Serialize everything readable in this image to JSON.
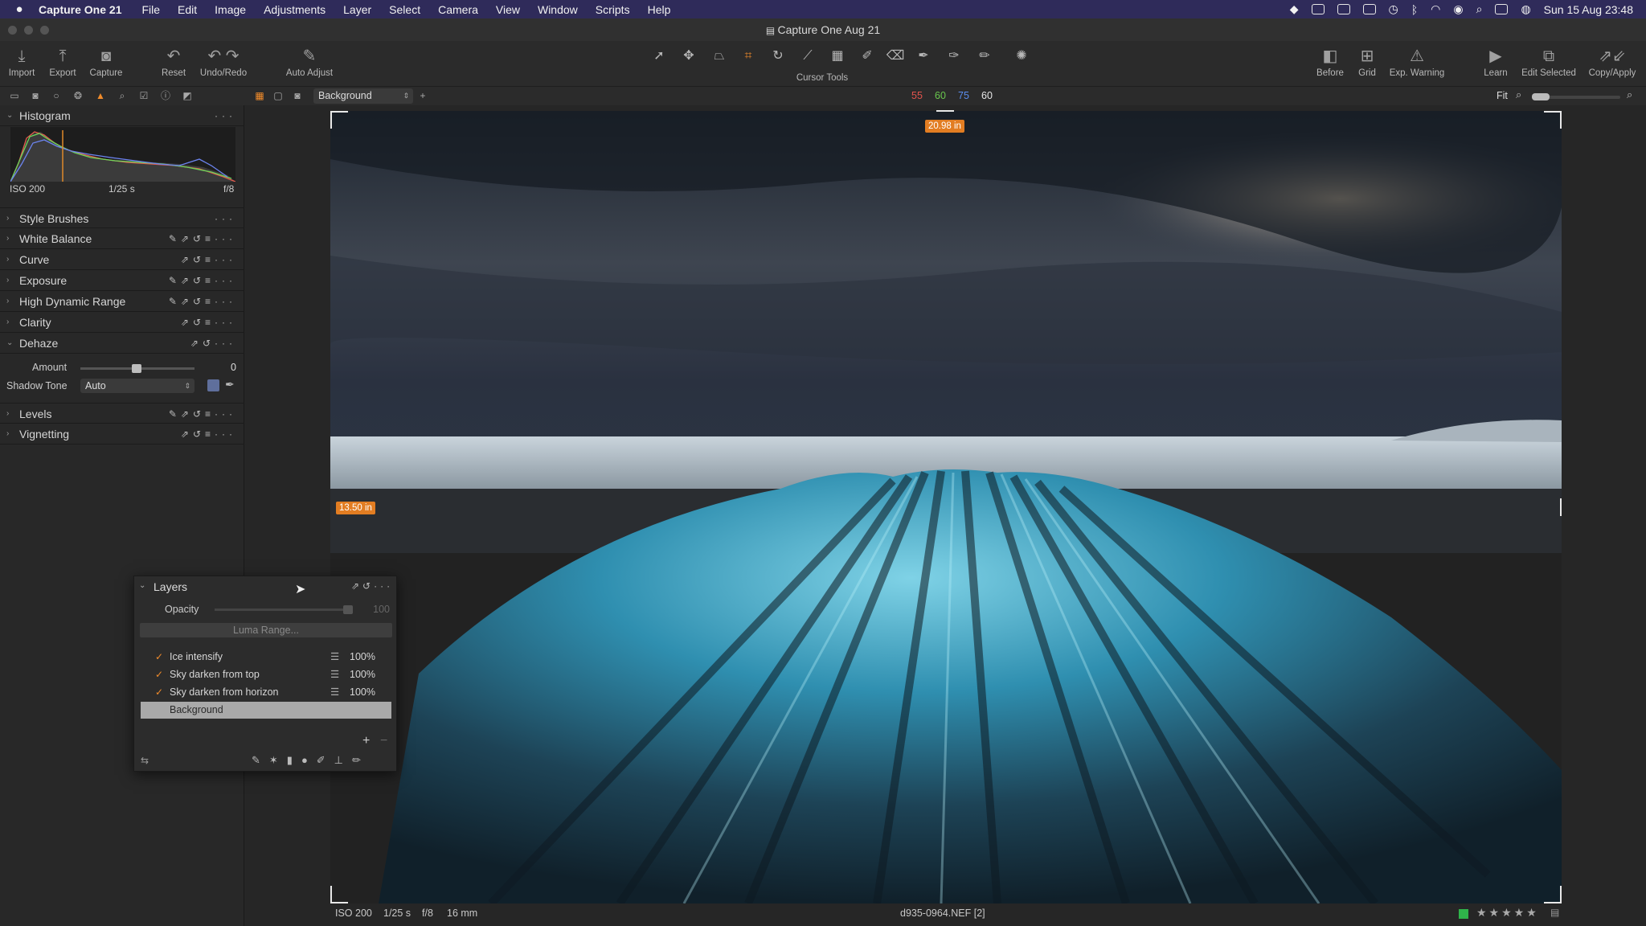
{
  "menubar": {
    "app_name": "Capture One 21",
    "items": [
      "File",
      "Edit",
      "Image",
      "Adjustments",
      "Layer",
      "Select",
      "Camera",
      "View",
      "Window",
      "Scripts",
      "Help"
    ],
    "clock": "Sun 15 Aug  23:48"
  },
  "window": {
    "title": "Capture One Aug 21"
  },
  "toolbar": {
    "left": [
      {
        "label": "Import",
        "icon": "import-icon"
      },
      {
        "label": "Export",
        "icon": "export-icon"
      },
      {
        "label": "Capture",
        "icon": "camera-icon"
      },
      {
        "label": "Reset",
        "icon": "reset-icon"
      },
      {
        "label": "Undo/Redo",
        "icon": "undo-redo-icon"
      },
      {
        "label": "Auto Adjust",
        "icon": "magic-wand-icon"
      }
    ],
    "cursor_tools_label": "Cursor Tools",
    "right": [
      {
        "label": "Before",
        "icon": "before-icon"
      },
      {
        "label": "Grid",
        "icon": "grid-icon"
      },
      {
        "label": "Exp. Warning",
        "icon": "warning-icon"
      },
      {
        "label": "Learn",
        "icon": "learn-icon"
      },
      {
        "label": "Edit Selected",
        "icon": "edit-selected-icon"
      },
      {
        "label": "Copy/Apply",
        "icon": "copy-apply-icon"
      }
    ]
  },
  "tabrow": {
    "layer_select": "Background",
    "readout": {
      "r": "55",
      "g": "60",
      "b": "75",
      "l": "60"
    },
    "zoom": "Fit"
  },
  "histogram": {
    "title": "Histogram",
    "iso": "ISO 200",
    "shutter": "1/25 s",
    "aperture": "f/8"
  },
  "tools": [
    {
      "label": "Style Brushes",
      "expanded": false
    },
    {
      "label": "White Balance",
      "expanded": false
    },
    {
      "label": "Curve",
      "expanded": false
    },
    {
      "label": "Exposure",
      "expanded": false
    },
    {
      "label": "High Dynamic Range",
      "expanded": false
    },
    {
      "label": "Clarity",
      "expanded": false
    },
    {
      "label": "Dehaze",
      "expanded": true
    },
    {
      "label": "Levels",
      "expanded": false
    },
    {
      "label": "Vignetting",
      "expanded": false
    }
  ],
  "dehaze": {
    "amount_label": "Amount",
    "amount_value": "0",
    "shadow_tone_label": "Shadow Tone",
    "shadow_tone_value": "Auto"
  },
  "layers_panel": {
    "title": "Layers",
    "opacity_label": "Opacity",
    "opacity_value": "100",
    "luma_range": "Luma Range...",
    "layers": [
      {
        "name": "Ice intensify",
        "opacity": "100%",
        "checked": true
      },
      {
        "name": "Sky darken from top",
        "opacity": "100%",
        "checked": true
      },
      {
        "name": "Sky darken from horizon",
        "opacity": "100%",
        "checked": true
      },
      {
        "name": "Background",
        "opacity": "",
        "checked": false
      }
    ]
  },
  "viewer": {
    "width_badge": "20.98 in",
    "height_badge": "13.50 in"
  },
  "status": {
    "iso": "ISO 200",
    "shutter": "1/25 s",
    "aperture": "f/8",
    "focal": "16 mm",
    "filename": "d935-0964.NEF [2]",
    "rating": "★★★★★"
  },
  "colors": {
    "accent": "#f08b2b",
    "menubar": "#2f2b5a",
    "badge": "#e27d22",
    "color_tag": "#2fb44a"
  }
}
